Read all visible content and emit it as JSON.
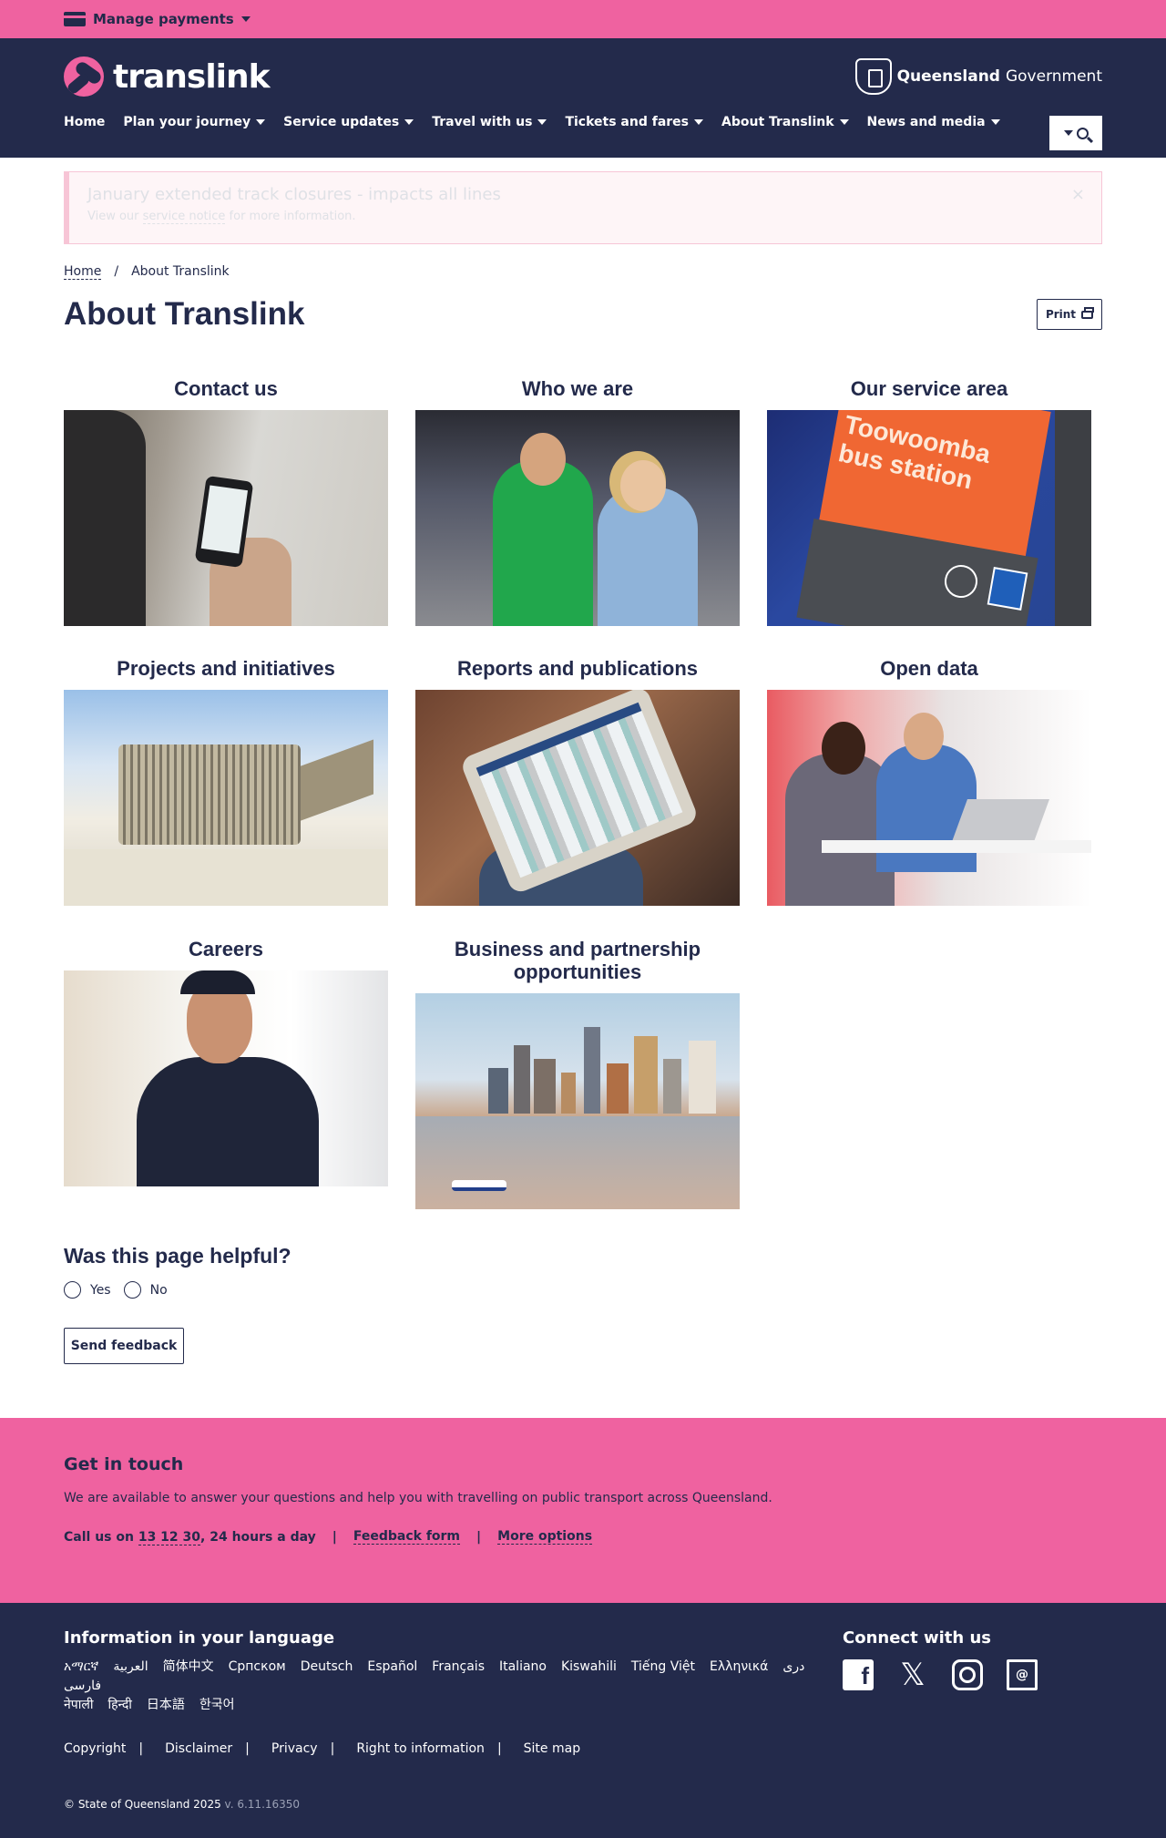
{
  "topbar": {
    "manage_payments": "Manage payments"
  },
  "header": {
    "logo_text": "translink",
    "gov_bold": "Queensland",
    "gov_light": "Government",
    "nav": [
      {
        "label": "Home",
        "dropdown": false
      },
      {
        "label": "Plan your journey",
        "dropdown": true
      },
      {
        "label": "Service updates",
        "dropdown": true
      },
      {
        "label": "Travel with us",
        "dropdown": true
      },
      {
        "label": "Tickets and fares",
        "dropdown": true
      },
      {
        "label": "About Translink",
        "dropdown": true
      },
      {
        "label": "News and media",
        "dropdown": true
      }
    ]
  },
  "alert": {
    "title": "January extended track closures - impacts all lines",
    "text_before": "View our ",
    "link": "service notice",
    "text_after": " for more information.",
    "close": "×"
  },
  "breadcrumb": {
    "home": "Home",
    "sep": "/",
    "current": "About Translink"
  },
  "page_title": "About Translink",
  "print_label": "Print",
  "cards": [
    {
      "title": "Contact us"
    },
    {
      "title": "Who we are"
    },
    {
      "title": "Our service area",
      "sign_text": "Toowoomba bus station"
    },
    {
      "title": "Projects and initiatives"
    },
    {
      "title": "Reports and publications"
    },
    {
      "title": "Open data"
    },
    {
      "title": "Careers"
    },
    {
      "title": "Business and partnership opportunities"
    }
  ],
  "feedback": {
    "question": "Was this page helpful?",
    "yes": "Yes",
    "no": "No",
    "send": "Send feedback"
  },
  "touch": {
    "title": "Get in touch",
    "text": "We are available to answer your questions and help you with travelling on public transport across Queensland.",
    "call_prefix": "Call us on ",
    "phone": "13 12 30",
    "call_suffix": ", 24 hours a day",
    "feedback_form": "Feedback form",
    "more_options": "More options",
    "sep": "|"
  },
  "footer": {
    "lang_title": "Information in your language",
    "languages": [
      "አማርኛ",
      "العربية",
      "简体中文",
      "Српском",
      "Deutsch",
      "Español",
      "Français",
      "Italiano",
      "Kiswahili",
      "Tiếng Việt",
      "Ελληνικά",
      "دری",
      "فارسی",
      "नेपाली",
      "हिन्दी",
      "日本語",
      "한국어"
    ],
    "connect_title": "Connect with us",
    "legal": [
      "Copyright",
      "Disclaimer",
      "Privacy",
      "Right to information",
      "Site map"
    ],
    "legal_sep": "|",
    "copyright": "© State of Queensland 2025",
    "version": "v. 6.11.16350"
  },
  "colors": {
    "pink": "#ef62a0",
    "navy": "#232a4b"
  },
  "icons": [
    "card-icon",
    "caret-down-icon",
    "search-icon",
    "printer-icon",
    "facebook-icon",
    "x-icon",
    "instagram-icon",
    "email-icon"
  ]
}
